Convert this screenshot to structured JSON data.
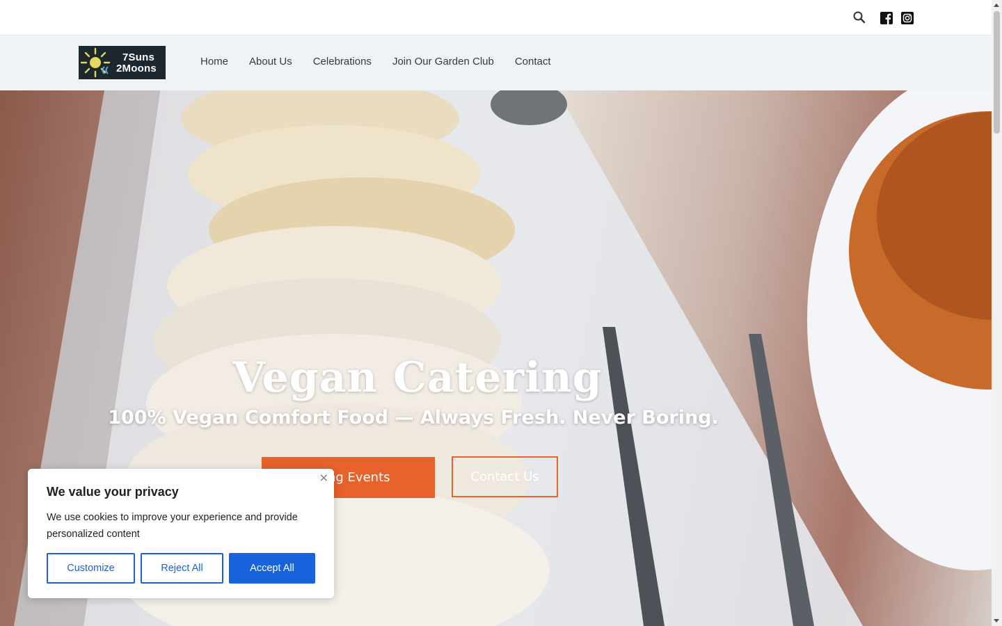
{
  "topbar": {
    "icons": [
      "search-icon",
      "facebook-icon",
      "instagram-icon"
    ]
  },
  "logo": {
    "line1": "7Suns",
    "line2": "2Moons"
  },
  "nav": {
    "items": [
      {
        "label": "Home"
      },
      {
        "label": "About Us"
      },
      {
        "label": "Celebrations"
      },
      {
        "label": "Join Our Garden Club"
      },
      {
        "label": "Contact"
      }
    ]
  },
  "hero": {
    "title": "Vegan Catering",
    "subtitle": "100% Vegan Comfort Food — Always Fresh. Never Boring.",
    "primary_button": "tering Events",
    "secondary_button": "Contact Us"
  },
  "cookie_banner": {
    "title": "We value your privacy",
    "body": "We use cookies to improve your experience and provide personalized content",
    "close": "×",
    "customize": "Customize",
    "reject": "Reject All",
    "accept": "Accept All"
  },
  "colors": {
    "accent_orange": "#e8622c",
    "cookie_blue": "#1863dc",
    "nav_bg": "#eef3f7"
  }
}
